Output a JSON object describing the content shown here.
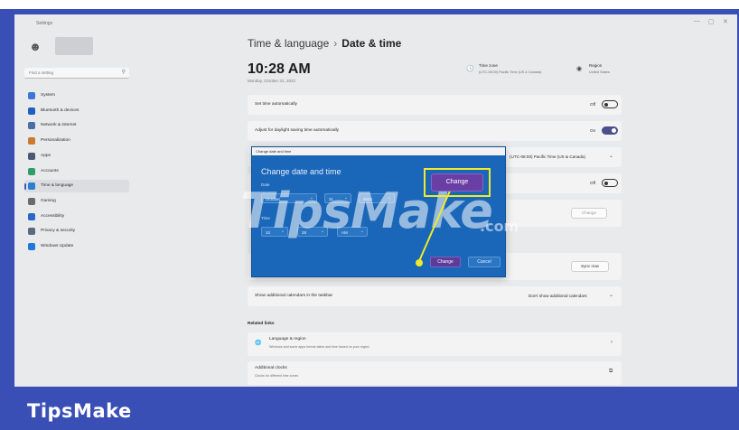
{
  "window": {
    "title": "Settings",
    "minimize": "—",
    "maximize": "▢",
    "close": "✕"
  },
  "sidebar": {
    "search_placeholder": "Find a setting",
    "items": [
      {
        "label": "System",
        "color": "#3b78d8"
      },
      {
        "label": "Bluetooth & devices",
        "color": "#1f5fbf"
      },
      {
        "label": "Network & internet",
        "color": "#4a6fa8"
      },
      {
        "label": "Personalization",
        "color": "#c97a2e"
      },
      {
        "label": "Apps",
        "color": "#4b5a73"
      },
      {
        "label": "Accounts",
        "color": "#2f9e6b"
      },
      {
        "label": "Time & language",
        "color": "#2a80d0"
      },
      {
        "label": "Gaming",
        "color": "#6b6b6b"
      },
      {
        "label": "Accessibility",
        "color": "#2a67c7"
      },
      {
        "label": "Privacy & security",
        "color": "#5a6b80"
      },
      {
        "label": "Windows Update",
        "color": "#1f7ad6"
      }
    ],
    "active_index": 6
  },
  "header": {
    "crumb_parent": "Time & language",
    "crumb_sep": "›",
    "crumb_current": "Date & time",
    "time": "10:28 AM",
    "date": "Monday, October 31, 2022",
    "timezone_label": "Time zone",
    "timezone_value": "(UTC-08:00) Pacific Time (US & Canada)",
    "region_label": "Region",
    "region_value": "United States"
  },
  "rows": {
    "set_time_auto": {
      "label": "Set time automatically",
      "state": "Off"
    },
    "dst_auto": {
      "label": "Adjust for daylight saving time automatically",
      "state": "On"
    },
    "timezone": {
      "value": "(UTC-08:00) Pacific Time (US & Canada)"
    },
    "set_tz_auto": {
      "state": "Off"
    },
    "manual_change": {
      "button": "Change"
    },
    "sync_now": {
      "button": "Sync now"
    },
    "calendars": {
      "label": "Show additional calendars in the taskbar",
      "value": "Don't show additional calendars"
    }
  },
  "related": {
    "heading": "Related links",
    "language_region": {
      "label": "Language & region",
      "sub": "Windows and some apps format dates and time based on your region"
    },
    "additional_clocks": {
      "label": "Additional clocks",
      "sub": "Clocks for different time zones"
    }
  },
  "dialog": {
    "titlebar": "Change date and time",
    "heading": "Change date and time",
    "date_label": "Date",
    "month": "October",
    "day": "31",
    "year": "2022",
    "time_label": "Time",
    "hour": "10",
    "minute": "28",
    "ampm": "AM",
    "change_button": "Change",
    "cancel_button": "Cancel"
  },
  "callout": {
    "button": "Change",
    "color": "#f1ea2a"
  },
  "watermark": {
    "text": "TipsMake",
    "suffix": ".com"
  },
  "brand": {
    "text": "TipsMake",
    "bar_color": "#3a4fb5"
  }
}
